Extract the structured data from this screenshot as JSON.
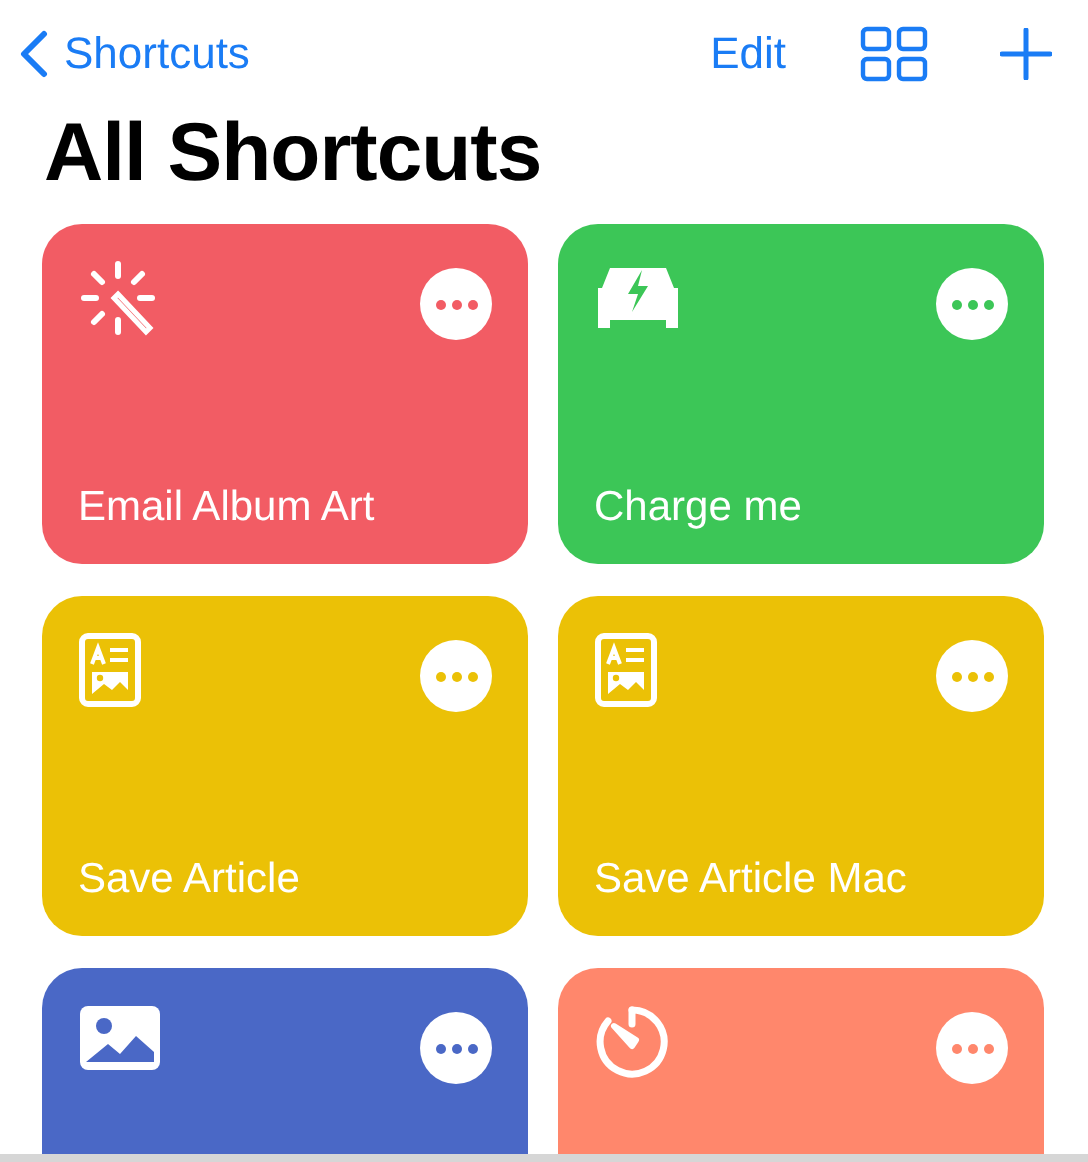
{
  "nav": {
    "back_label": "Shortcuts",
    "edit_label": "Edit"
  },
  "title": "All Shortcuts",
  "shortcuts": [
    {
      "name": "Email Album Art",
      "color": "#f25c64"
    },
    {
      "name": "Charge me",
      "color": "#3cc657"
    },
    {
      "name": "Save Article",
      "color": "#ebc106"
    },
    {
      "name": "Save Article Mac",
      "color": "#ebc106"
    },
    {
      "color": "#4a68c6"
    },
    {
      "color": "#ff876c"
    }
  ]
}
